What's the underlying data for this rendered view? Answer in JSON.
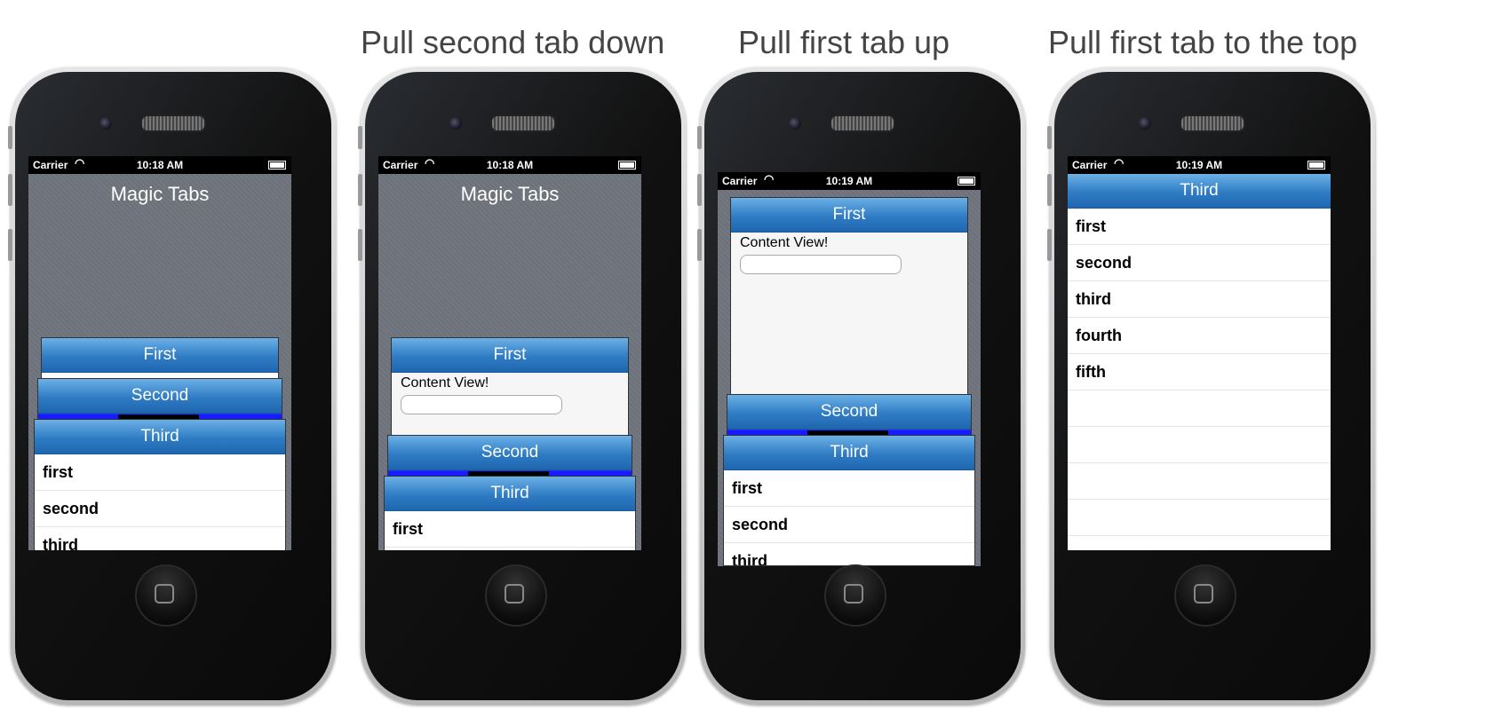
{
  "captions": [
    "Pull second tab down",
    "Pull first tab up",
    "Pull first tab to the top"
  ],
  "status": [
    {
      "carrier": "Carrier",
      "time": "10:18 AM"
    },
    {
      "carrier": "Carrier",
      "time": "10:18 AM"
    },
    {
      "carrier": "Carrier",
      "time": "10:19 AM"
    },
    {
      "carrier": "Carrier",
      "time": "10:19 AM"
    }
  ],
  "app_title": "Magic Tabs",
  "tabs": {
    "first": "First",
    "second": "Second",
    "third": "Third"
  },
  "content": {
    "label": "Content View!",
    "input_value": ""
  },
  "list_items": [
    "first",
    "second",
    "third",
    "fourth",
    "fifth"
  ]
}
